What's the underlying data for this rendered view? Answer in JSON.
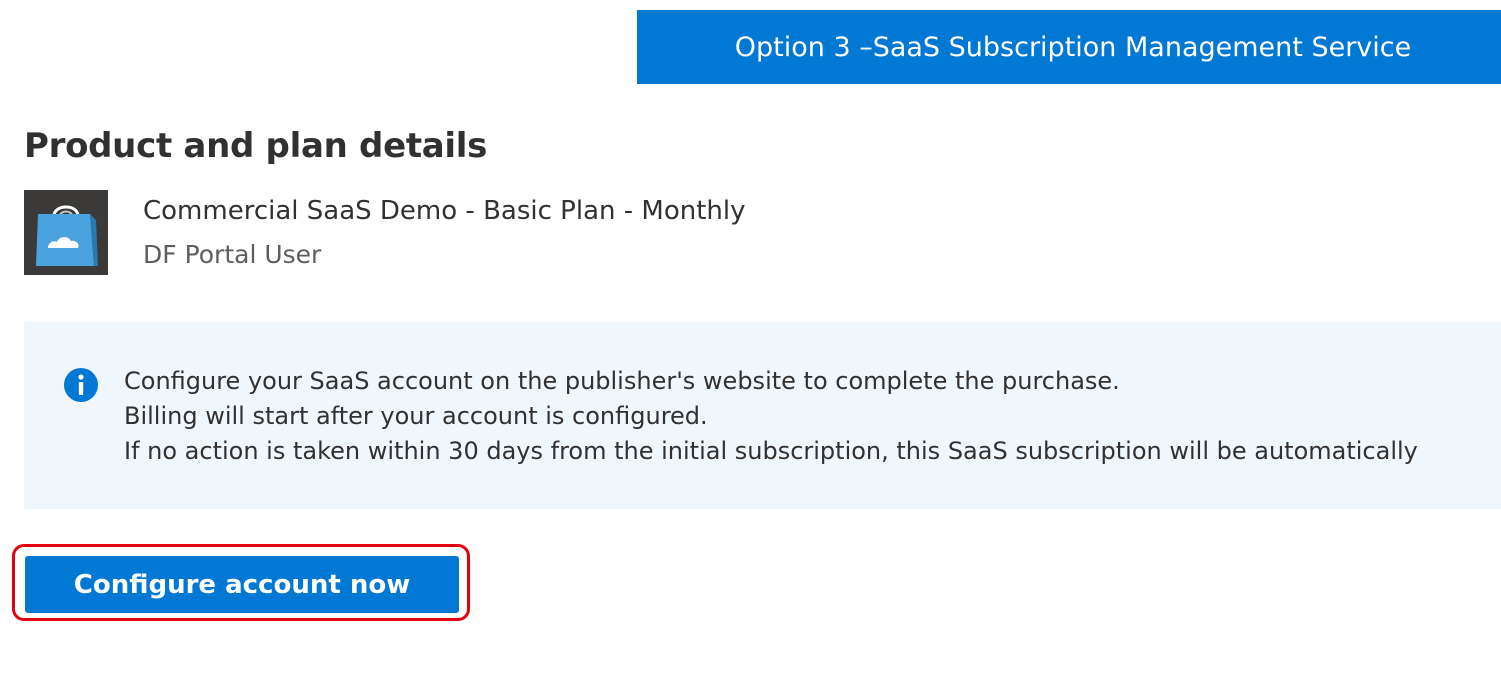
{
  "banner": {
    "text": "Option 3 –SaaS Subscription Management Service"
  },
  "page": {
    "title": "Product and plan details"
  },
  "product": {
    "icon": "shopping-bag-cloud-icon",
    "name": "Commercial SaaS Demo - Basic Plan - Monthly",
    "publisher": "DF Portal User"
  },
  "info": {
    "icon": "info-icon",
    "lines": [
      "Configure your SaaS account on the publisher's website to complete the purchase.",
      "Billing will start after your account is configured.",
      "If no action is taken within 30 days from the initial subscription, this SaaS subscription will be automatically"
    ]
  },
  "actions": {
    "configure_label": "Configure account now"
  },
  "colors": {
    "accent": "#0078d4",
    "info_background": "#eff6fc",
    "highlight": "#e3000f"
  }
}
